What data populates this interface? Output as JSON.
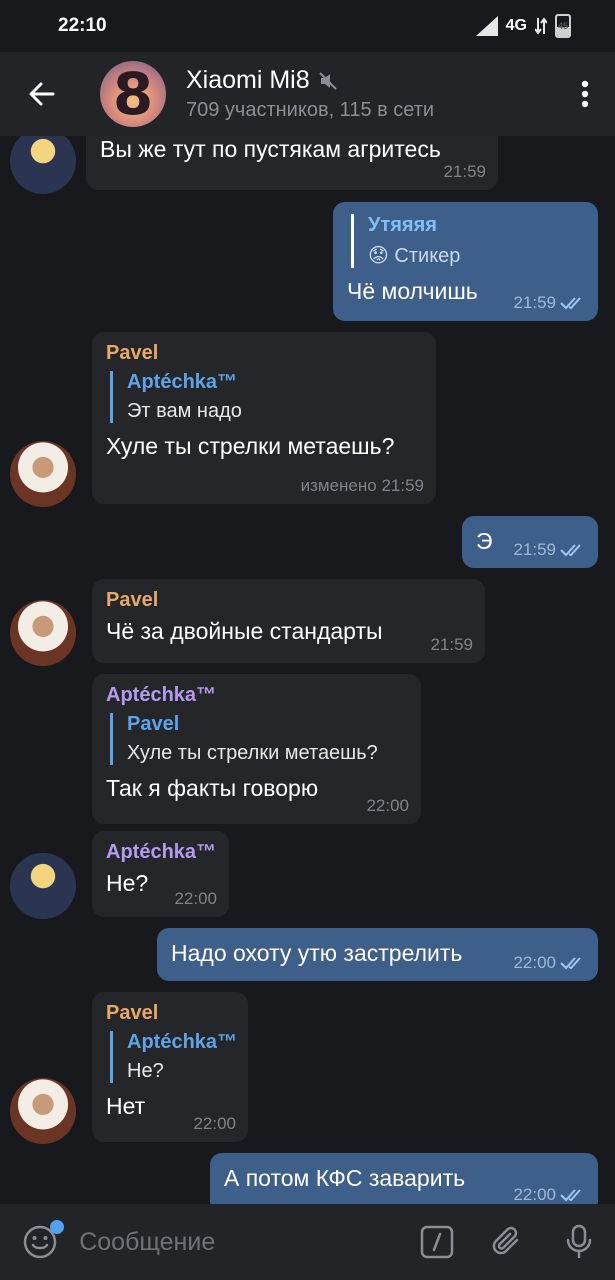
{
  "status": {
    "time": "22:10",
    "network": "4G",
    "battery": "45"
  },
  "header": {
    "title": "Xiaomi Mi8",
    "avatar_glyph": "8",
    "subtitle": "709 участников, 115 в сети"
  },
  "messages": [
    {
      "type": "in",
      "text": "Вы же тут по пустякам агритесь",
      "time": "21:59",
      "avatar": "aptechka"
    },
    {
      "type": "out",
      "reply_name": "Утяяяя",
      "reply_emoji": "😟",
      "reply_text": "Стикер",
      "text": "Чё молчишь",
      "time": "21:59"
    },
    {
      "type": "in",
      "sender": "Pavel",
      "reply_name": "Aptéchka™",
      "reply_text": "Эт вам надо",
      "text": "Хуле ты стрелки метаешь?",
      "time": "изменено 21:59",
      "avatar": "pavel"
    },
    {
      "type": "out",
      "text": "Э",
      "time": "21:59"
    },
    {
      "type": "in",
      "sender": "Pavel",
      "text": "Чё за двойные стандарты",
      "time": "21:59",
      "avatar": "pavel"
    },
    {
      "type": "in",
      "sender": "Aptéchka™",
      "reply_name": "Pavel",
      "reply_text": "Хуле ты стрелки метаешь?",
      "text": "Так я факты говорю",
      "time": "22:00"
    },
    {
      "type": "in",
      "sender": "Aptéchka™",
      "text": "Не?",
      "time": "22:00",
      "avatar": "aptechka"
    },
    {
      "type": "out",
      "text": "Надо охоту утю застрелить",
      "time": "22:00"
    },
    {
      "type": "in",
      "sender": "Pavel",
      "reply_name": "Aptéchka™",
      "reply_text": "Не?",
      "text": "Нет",
      "time": "22:00",
      "avatar": "pavel"
    },
    {
      "type": "out",
      "text": "А потом КФС заварить",
      "time": "22:00"
    }
  ],
  "input": {
    "placeholder": "Сообщение"
  },
  "colors": {
    "background": "#18191d",
    "incoming": "#242629",
    "outgoing": "#3e5f8a",
    "accent": "#5ea3e8",
    "pavel_name": "#e8a968",
    "aptechka_name": "#b59bf0"
  }
}
